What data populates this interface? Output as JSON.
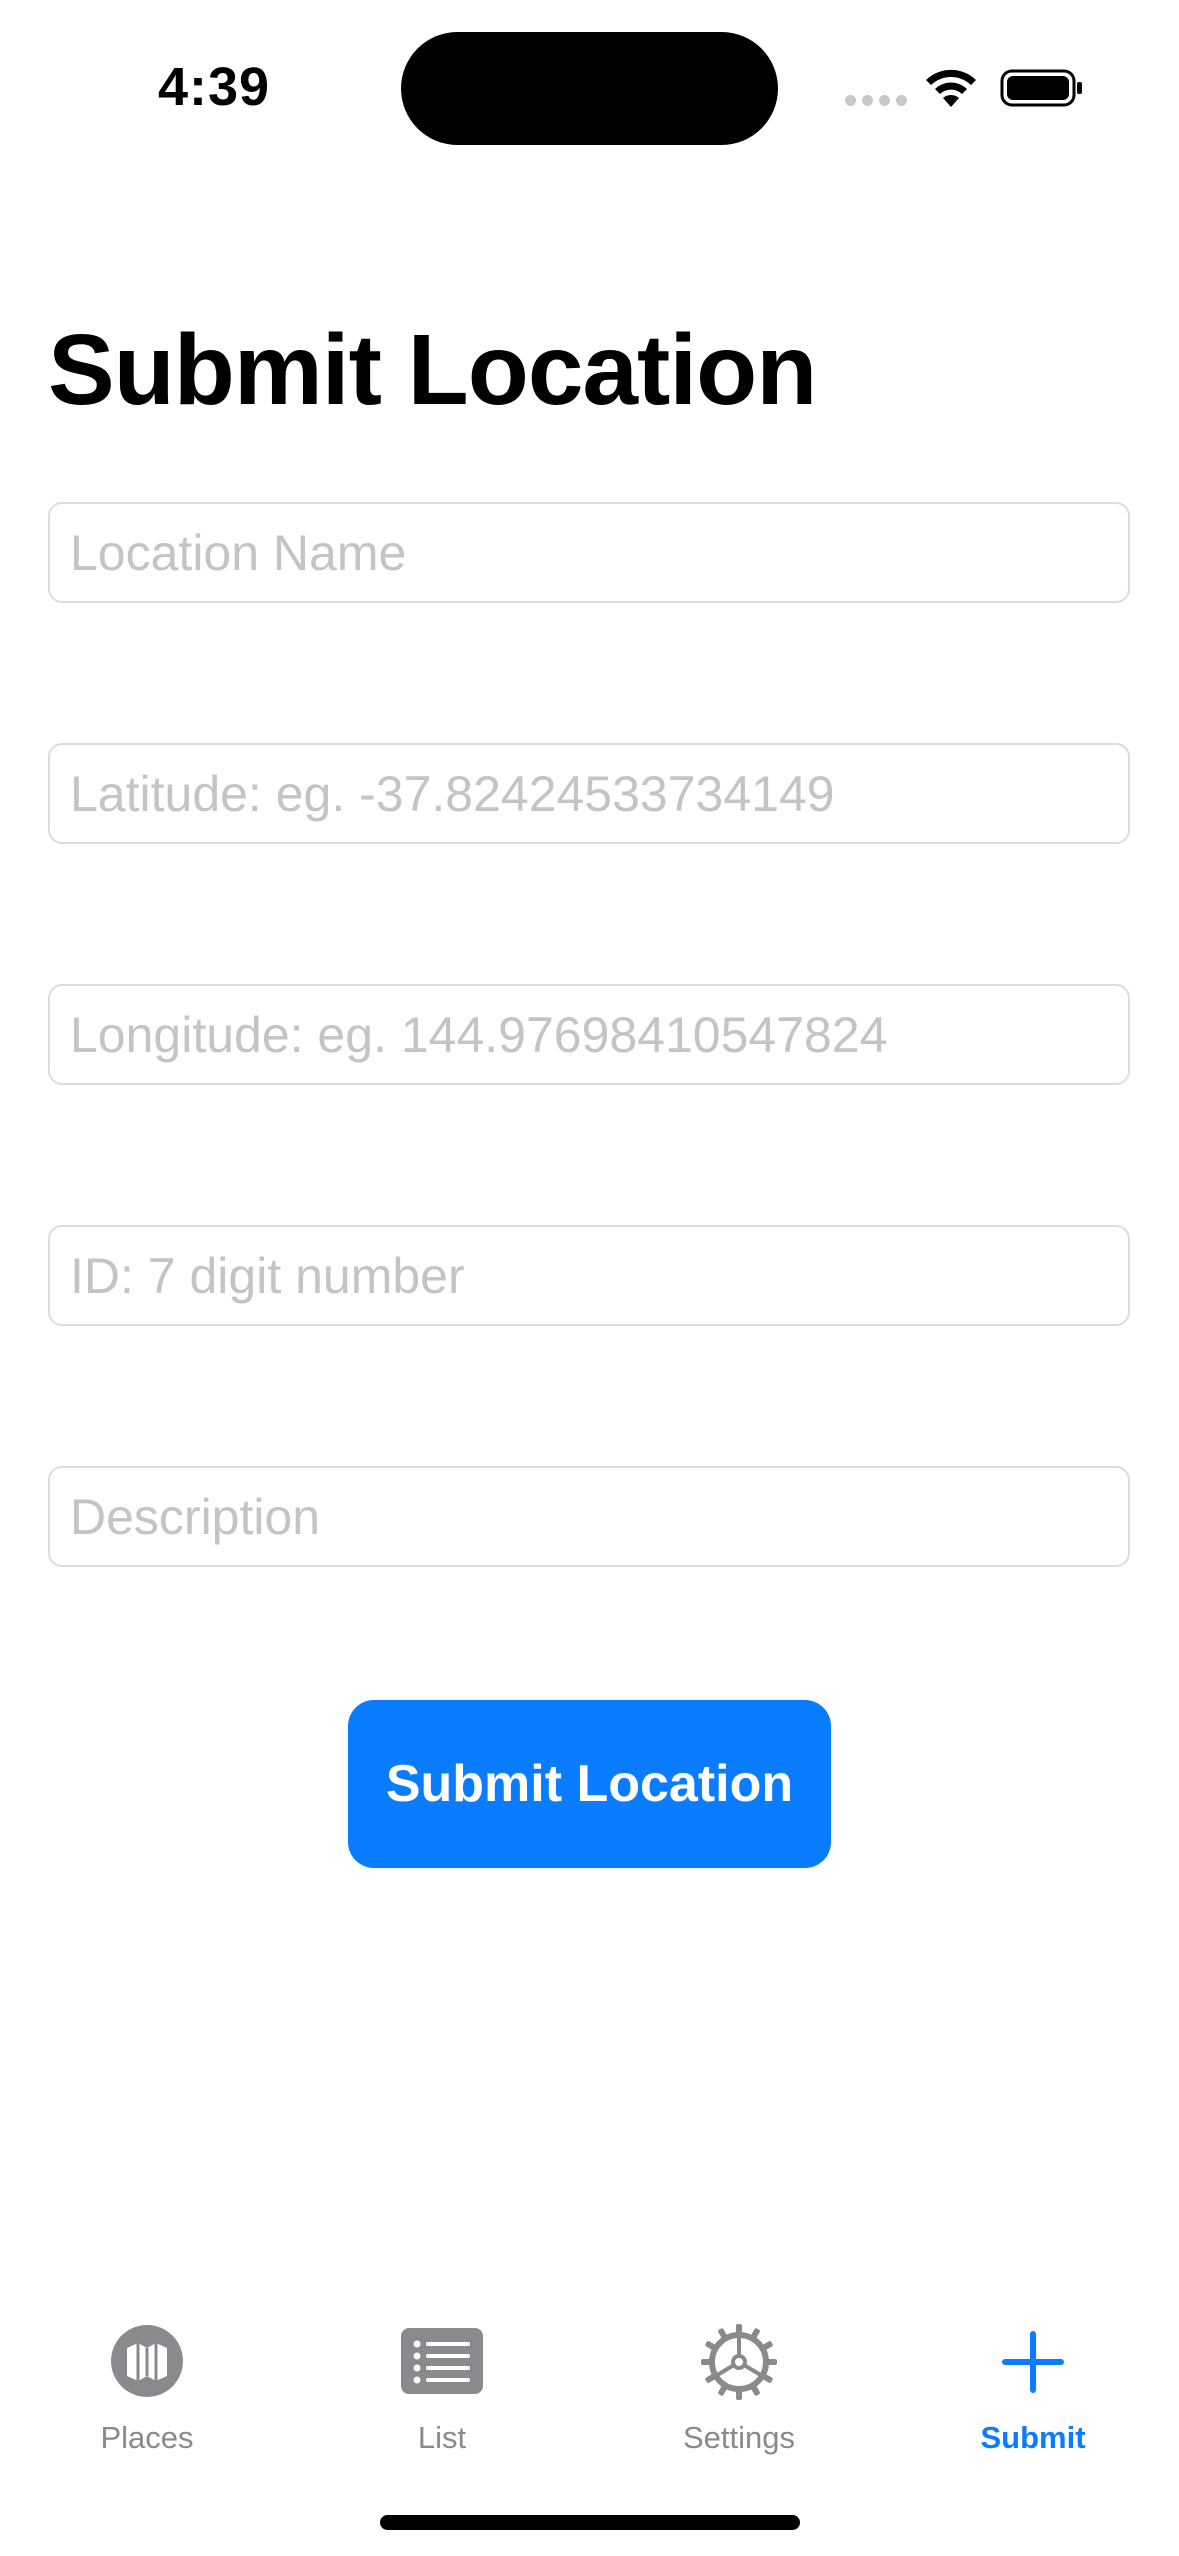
{
  "status_bar": {
    "time": "4:39",
    "icons": [
      "cellular-signal-icon",
      "wifi-icon",
      "battery-icon"
    ]
  },
  "page": {
    "title": "Submit Location"
  },
  "form": {
    "fields": [
      {
        "name": "location-name",
        "placeholder": "Location Name",
        "value": ""
      },
      {
        "name": "latitude",
        "placeholder": "Latitude: eg. -37.82424533734149",
        "value": ""
      },
      {
        "name": "longitude",
        "placeholder": "Longitude: eg. 144.97698410547824",
        "value": ""
      },
      {
        "name": "id",
        "placeholder": "ID: 7 digit number",
        "value": ""
      },
      {
        "name": "description",
        "placeholder": "Description",
        "value": ""
      }
    ],
    "submit_label": "Submit Location"
  },
  "tab_bar": {
    "tabs": [
      {
        "label": "Places",
        "icon": "map-icon",
        "active": false
      },
      {
        "label": "List",
        "icon": "list-icon",
        "active": false
      },
      {
        "label": "Settings",
        "icon": "gear-icon",
        "active": false
      },
      {
        "label": "Submit",
        "icon": "plus-icon",
        "active": true
      }
    ]
  },
  "colors": {
    "accent": "#0a7cff",
    "inactive_tab": "#8a8a8e",
    "placeholder": "#c4c4c6",
    "field_border": "#dcdcdc"
  }
}
